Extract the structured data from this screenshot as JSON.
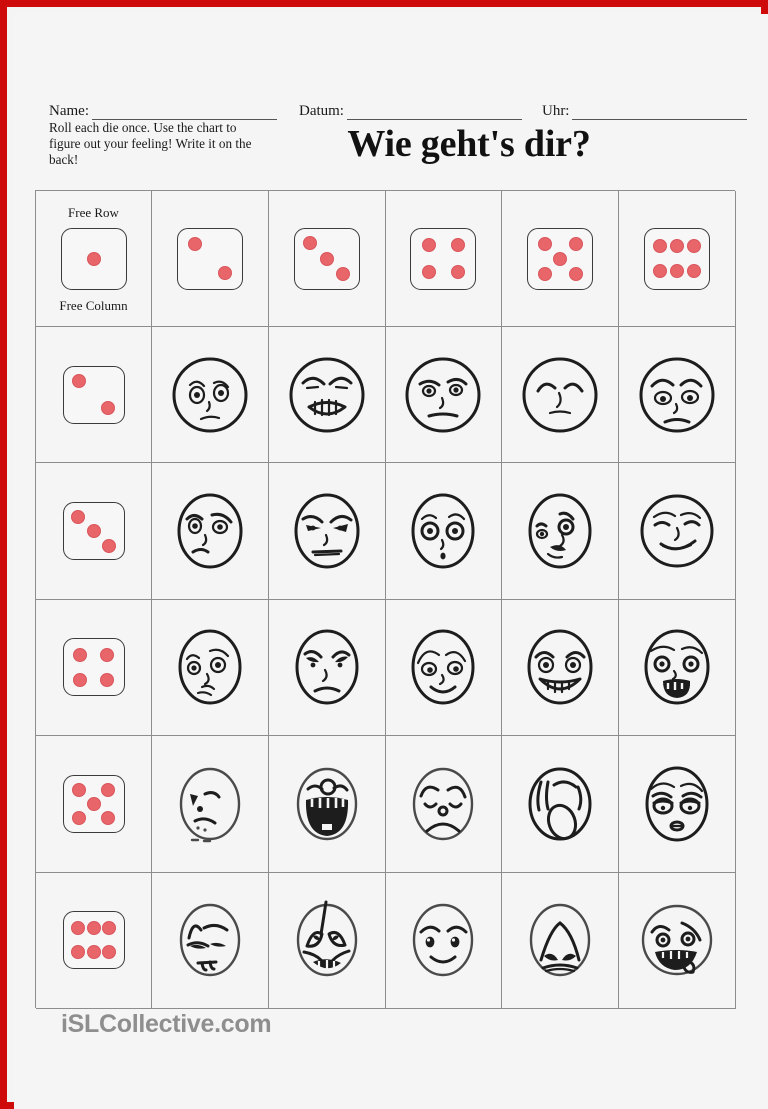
{
  "page": {
    "border_color": "#cf0a0a",
    "background": "#f5f5f5"
  },
  "header": {
    "name_label": "Name:",
    "datum_label": "Datum:",
    "uhr_label": "Uhr:",
    "instructions": "Roll each die once. Use the chart to figure out your feeling! Write it on the back!",
    "title": "Wie geht's dir?"
  },
  "grid": {
    "corner": {
      "free_row_label": "Free Row",
      "free_column_label": "Free Column"
    },
    "pip_color": "#e8656a",
    "column_dice": [
      1,
      2,
      3,
      4,
      5,
      6
    ],
    "row_dice": [
      2,
      3,
      4,
      5,
      6
    ],
    "faces": [
      [
        {
          "name": "sad-worried-face",
          "emotion": "sad"
        },
        {
          "name": "angry-gritted-teeth-face",
          "emotion": "angry"
        },
        {
          "name": "annoyed-face",
          "emotion": "annoyed"
        },
        {
          "name": "relieved-face",
          "emotion": "relieved"
        },
        {
          "name": "tired-sad-face",
          "emotion": "tired"
        }
      ],
      [
        {
          "name": "grumpy-face",
          "emotion": "grumpy"
        },
        {
          "name": "furious-face",
          "emotion": "furious"
        },
        {
          "name": "surprised-face",
          "emotion": "surprised"
        },
        {
          "name": "winking-smirk-face",
          "emotion": "smirking"
        },
        {
          "name": "smug-smile-face",
          "emotion": "smug"
        }
      ],
      [
        {
          "name": "confused-face",
          "emotion": "confused"
        },
        {
          "name": "unhappy-face",
          "emotion": "unhappy"
        },
        {
          "name": "shy-smile-face",
          "emotion": "shy"
        },
        {
          "name": "grinning-face",
          "emotion": "grinning"
        },
        {
          "name": "shocked-open-mouth-face",
          "emotion": "shocked"
        }
      ],
      [
        {
          "name": "upset-face",
          "emotion": "upset"
        },
        {
          "name": "laughing-wide-open-face",
          "emotion": "laughing"
        },
        {
          "name": "sad-frown-face",
          "emotion": "sad"
        },
        {
          "name": "yawning-face",
          "emotion": "yawning"
        },
        {
          "name": "sleepy-face",
          "emotion": "sleepy"
        }
      ],
      [
        {
          "name": "disgusted-face",
          "emotion": "disgusted"
        },
        {
          "name": "crying-face",
          "emotion": "crying"
        },
        {
          "name": "happy-face",
          "emotion": "happy"
        },
        {
          "name": "distressed-face",
          "emotion": "distressed"
        },
        {
          "name": "mischievous-tongue-face",
          "emotion": "mischievous"
        }
      ]
    ]
  },
  "footer": {
    "watermark": "iSLCollective.com"
  }
}
